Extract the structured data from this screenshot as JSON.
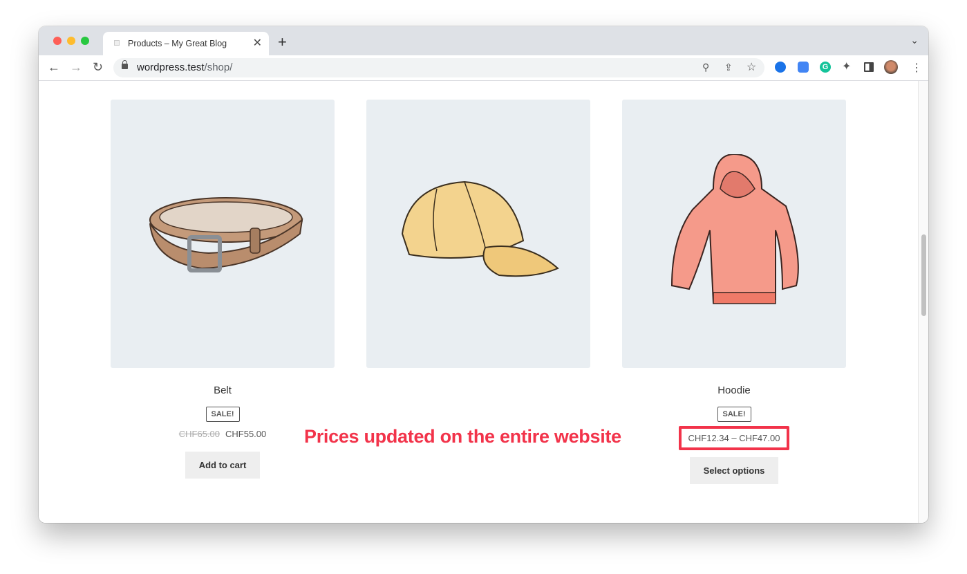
{
  "browser": {
    "tab_title": "Products – My Great Blog",
    "url_host": "wordpress.test",
    "url_path": "/shop/"
  },
  "products": [
    {
      "name": "Belt",
      "badge": "SALE!",
      "old_price": "CHF65.00",
      "price": "CHF55.00",
      "button": "Add to cart",
      "image": "belt"
    },
    {
      "name": "",
      "image": "cap"
    },
    {
      "name": "Hoodie",
      "badge": "SALE!",
      "price": "CHF12.34 – CHF47.00",
      "button": "Select options",
      "image": "hoodie"
    }
  ],
  "annotation": "Prices updated on the entire website",
  "colors": {
    "annotation": "#f2334a",
    "image_bg": "#e9eef2"
  }
}
